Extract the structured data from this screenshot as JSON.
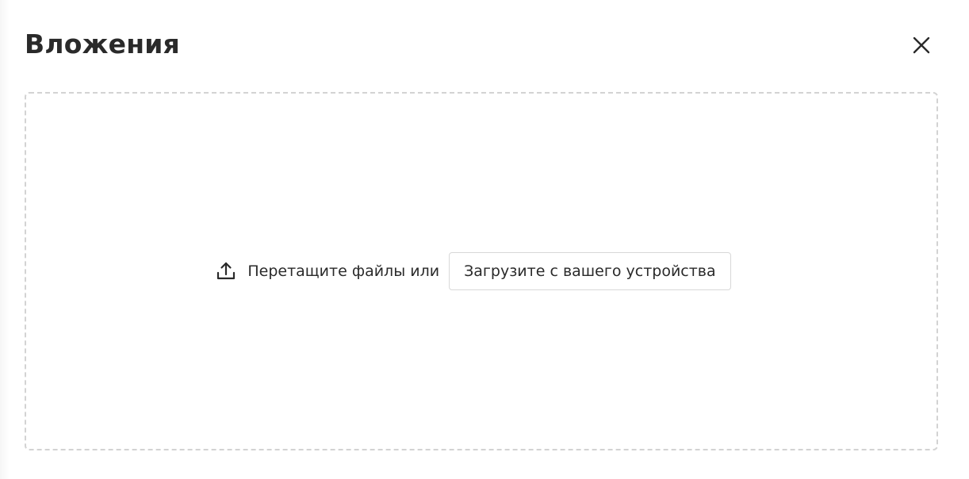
{
  "dialog": {
    "title": "Вложения",
    "close_icon": "close-icon"
  },
  "dropzone": {
    "icon": "upload-icon",
    "drag_text": "Перетащите файлы или",
    "upload_button_label": "Загрузите с вашего устройства"
  },
  "colors": {
    "dropzone_border": "#d3d3d3",
    "text": "#2a2a2a"
  }
}
